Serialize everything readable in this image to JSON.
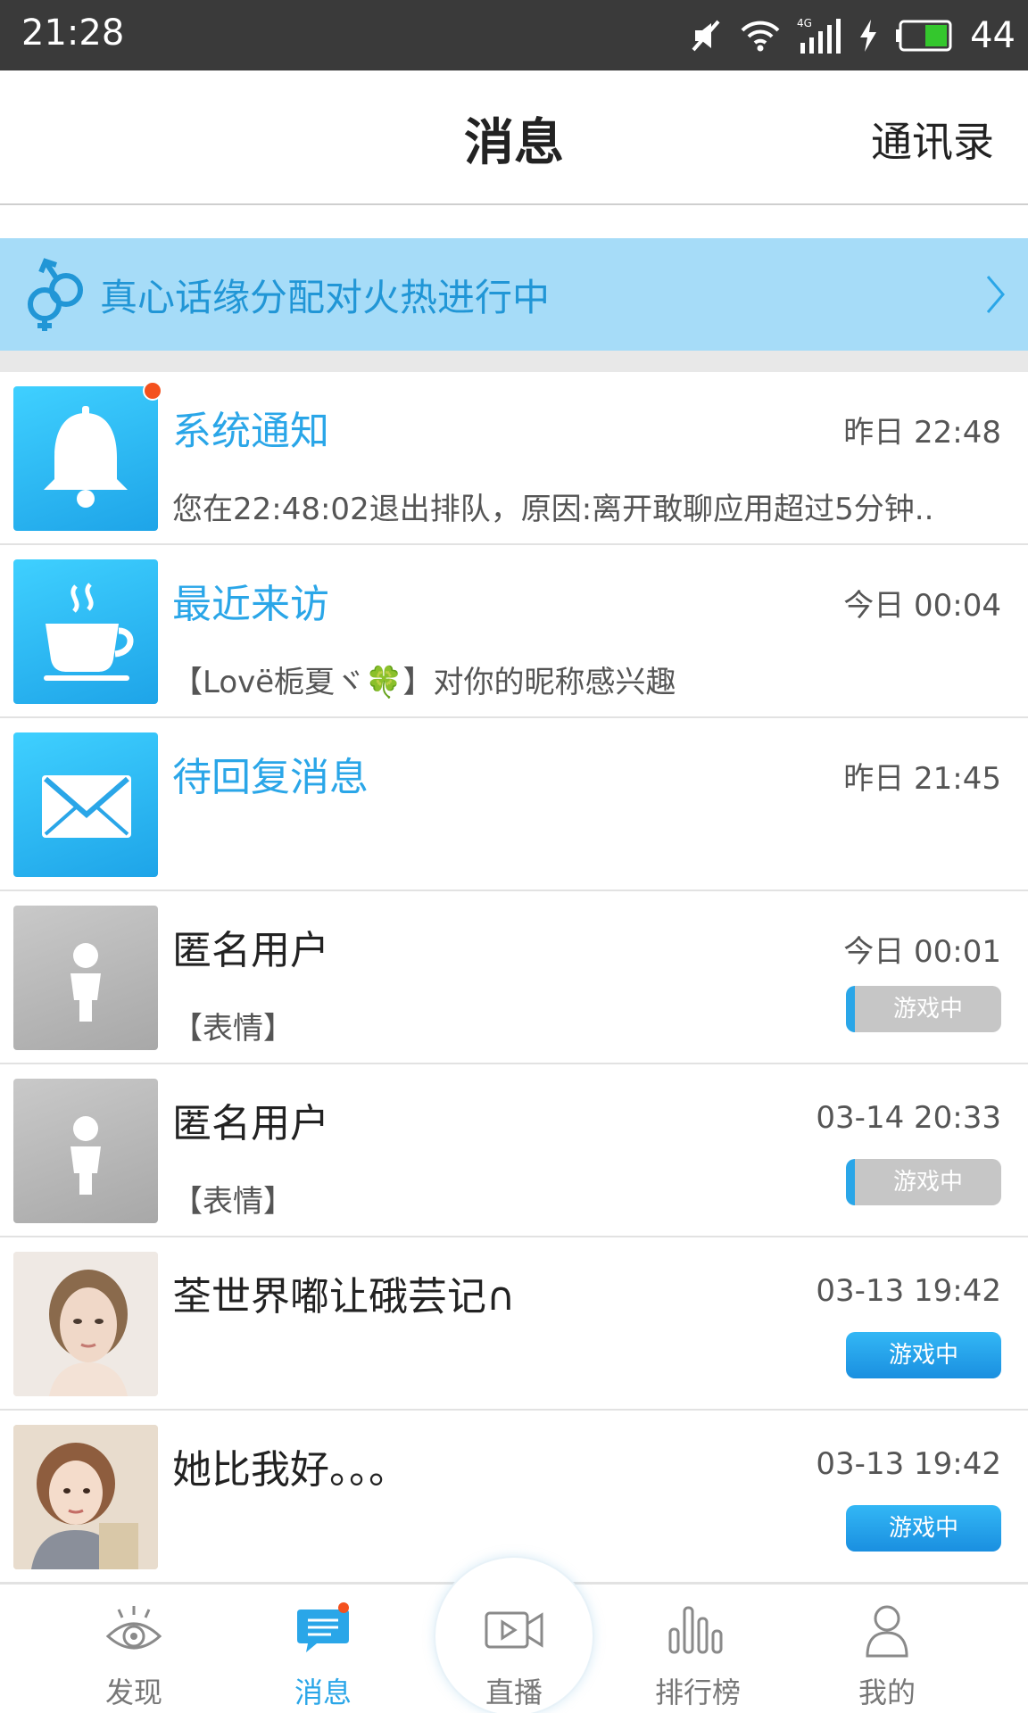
{
  "status_bar": {
    "time": "21:28",
    "battery": "44"
  },
  "header": {
    "title": "消息",
    "contacts": "通讯录"
  },
  "banner": {
    "text": "真心话缘分配对火热进行中"
  },
  "messages": [
    {
      "name": "系统通知",
      "time": "昨日 22:48",
      "preview": "您在22:48:02退出排队，原因:离开敢聊应用超过5分钟..",
      "status": ""
    },
    {
      "name": "最近来访",
      "time": "今日 00:04",
      "preview": "【Lovë栀夏ヾ🍀】对你的昵称感兴趣",
      "status": ""
    },
    {
      "name": "待回复消息",
      "time": "昨日 21:45",
      "preview": "",
      "status": ""
    },
    {
      "name": "匿名用户",
      "time": "今日 00:01",
      "preview": "【表情】",
      "status": "游戏中"
    },
    {
      "name": "匿名用户",
      "time": "03-14 20:33",
      "preview": "【表情】",
      "status": "游戏中"
    },
    {
      "name": "荃世界嘟让硪芸记∩",
      "time": "03-13 19:42",
      "preview": "",
      "status": "游戏中"
    },
    {
      "name": "她比我好。。。",
      "time": "03-13 19:42",
      "preview": "",
      "status": "游戏中"
    }
  ],
  "nav": [
    {
      "label": "发现",
      "icon": "eye-icon"
    },
    {
      "label": "消息",
      "icon": "message-icon"
    },
    {
      "label": "直播",
      "icon": "video-camera-icon"
    },
    {
      "label": "排行榜",
      "icon": "bar-chart-icon"
    },
    {
      "label": "我的",
      "icon": "person-icon"
    }
  ],
  "colors": {
    "accent": "#2aa6e8",
    "banner_bg": "#a6dcf8",
    "notify_dot": "#f4511e",
    "status_bar": "#3a3a3a"
  }
}
